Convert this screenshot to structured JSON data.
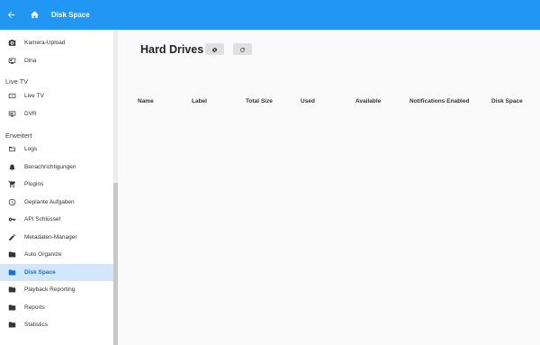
{
  "header": {
    "title": "Disk Space",
    "back_icon": "arrow-left-icon",
    "home_icon": "home-icon",
    "color": "#2196f3"
  },
  "sidebar": {
    "items_top": [
      {
        "label": "Kamera-Upload",
        "icon": "camera-icon"
      },
      {
        "label": "Dlna",
        "icon": "cast-screen-icon"
      }
    ],
    "section_livetv": "Live TV",
    "items_livetv": [
      {
        "label": "Live TV",
        "icon": "live-tv-icon"
      },
      {
        "label": "DVR",
        "icon": "dvr-icon"
      }
    ],
    "section_advanced": "Erweitert",
    "items_advanced": [
      {
        "label": "Logs",
        "icon": "folder-outline-icon"
      },
      {
        "label": "Benachrichtigungen",
        "icon": "bell-icon"
      },
      {
        "label": "Plugins",
        "icon": "cart-icon"
      },
      {
        "label": "Geplante Aufgaben",
        "icon": "clock-icon"
      },
      {
        "label": "API Schlüssel",
        "icon": "key-icon"
      },
      {
        "label": "Metadaten-Manager",
        "icon": "pencil-icon"
      },
      {
        "label": "Auto Organize",
        "icon": "folder-icon"
      },
      {
        "label": "Disk Space",
        "icon": "folder-icon",
        "active": true
      },
      {
        "label": "Playback Reporting",
        "icon": "folder-icon"
      },
      {
        "label": "Reports",
        "icon": "folder-icon"
      },
      {
        "label": "Statistics",
        "icon": "folder-icon"
      }
    ],
    "active_color": "#d2e7fb"
  },
  "main": {
    "title": "Hard Drives",
    "settings_icon": "gear-icon",
    "refresh_icon": "refresh-icon",
    "columns": [
      "Name",
      "Label",
      "Total Size",
      "Used",
      "Available",
      "Notifications Enabled",
      "Disk Space"
    ],
    "rows": []
  }
}
